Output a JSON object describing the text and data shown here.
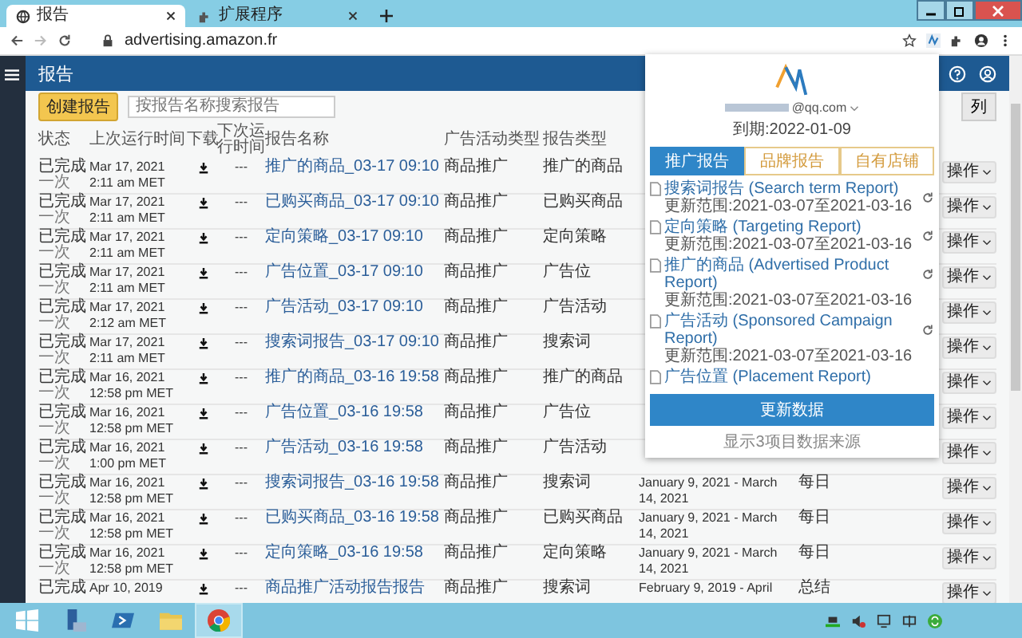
{
  "browser": {
    "tabs": [
      {
        "title": "报告",
        "selected": true
      },
      {
        "title": "扩展程序",
        "selected": false
      }
    ],
    "url": "advertising.amazon.fr"
  },
  "app": {
    "title": "报告",
    "create_button": "创建报告",
    "search": {
      "placeholder": "按报告名称搜索报告"
    },
    "columns_button": "列"
  },
  "table": {
    "columns": [
      "状态",
      "上次运行时间",
      "下载",
      "下次运行时间",
      "报告名称",
      "广告活动类型",
      "报告类型"
    ],
    "rows": [
      {
        "status": "已完成",
        "schedule": "一次",
        "last_run_date": "Mar 17, 2021",
        "last_run_time": "2:11 am MET",
        "next_run": "---",
        "name": "推广的商品_03-17 09:10",
        "campaign_type": "商品推广",
        "report_type": "推广的商品",
        "action": "操作"
      },
      {
        "status": "已完成",
        "schedule": "一次",
        "last_run_date": "Mar 17, 2021",
        "last_run_time": "2:11 am MET",
        "next_run": "---",
        "name": "已购买商品_03-17 09:10",
        "campaign_type": "商品推广",
        "report_type": "已购买商品",
        "action": "操作"
      },
      {
        "status": "已完成",
        "schedule": "一次",
        "last_run_date": "Mar 17, 2021",
        "last_run_time": "2:11 am MET",
        "next_run": "---",
        "name": "定向策略_03-17 09:10",
        "campaign_type": "商品推广",
        "report_type": "定向策略",
        "action": "操作"
      },
      {
        "status": "已完成",
        "schedule": "一次",
        "last_run_date": "Mar 17, 2021",
        "last_run_time": "2:11 am MET",
        "next_run": "---",
        "name": "广告位置_03-17 09:10",
        "campaign_type": "商品推广",
        "report_type": "广告位",
        "action": "操作"
      },
      {
        "status": "已完成",
        "schedule": "一次",
        "last_run_date": "Mar 17, 2021",
        "last_run_time": "2:12 am MET",
        "next_run": "---",
        "name": "广告活动_03-17 09:10",
        "campaign_type": "商品推广",
        "report_type": "广告活动",
        "action": "操作"
      },
      {
        "status": "已完成",
        "schedule": "一次",
        "last_run_date": "Mar 17, 2021",
        "last_run_time": "2:11 am MET",
        "next_run": "---",
        "name": "搜索词报告_03-17 09:10",
        "campaign_type": "商品推广",
        "report_type": "搜索词",
        "action": "操作"
      },
      {
        "status": "已完成",
        "schedule": "一次",
        "last_run_date": "Mar 16, 2021",
        "last_run_time": "12:58 pm MET",
        "next_run": "---",
        "name": "推广的商品_03-16 19:58",
        "campaign_type": "商品推广",
        "report_type": "推广的商品",
        "action": "操作"
      },
      {
        "status": "已完成",
        "schedule": "一次",
        "last_run_date": "Mar 16, 2021",
        "last_run_time": "12:58 pm MET",
        "next_run": "---",
        "name": "广告位置_03-16 19:58",
        "campaign_type": "商品推广",
        "report_type": "广告位",
        "action": "操作"
      },
      {
        "status": "已完成",
        "schedule": "一次",
        "last_run_date": "Mar 16, 2021",
        "last_run_time": "1:00 pm MET",
        "next_run": "---",
        "name": "广告活动_03-16 19:58",
        "campaign_type": "商品推广",
        "report_type": "广告活动",
        "action": "操作"
      },
      {
        "status": "已完成",
        "schedule": "一次",
        "last_run_date": "Mar 16, 2021",
        "last_run_time": "12:58 pm MET",
        "next_run": "---",
        "name": "搜索词报告_03-16 19:58",
        "campaign_type": "商品推广",
        "report_type": "搜索词",
        "date_range": "January 9, 2021 - March 14, 2021",
        "frequency": "每日",
        "action": "操作"
      },
      {
        "status": "已完成",
        "schedule": "一次",
        "last_run_date": "Mar 16, 2021",
        "last_run_time": "12:58 pm MET",
        "next_run": "---",
        "name": "已购买商品_03-16 19:58",
        "campaign_type": "商品推广",
        "report_type": "已购买商品",
        "date_range": "January 9, 2021 - March 14, 2021",
        "frequency": "每日",
        "action": "操作"
      },
      {
        "status": "已完成",
        "schedule": "一次",
        "last_run_date": "Mar 16, 2021",
        "last_run_time": "12:58 pm MET",
        "next_run": "---",
        "name": "定向策略_03-16 19:58",
        "campaign_type": "商品推广",
        "report_type": "定向策略",
        "date_range": "January 9, 2021 - March 14, 2021",
        "frequency": "每日",
        "action": "操作"
      },
      {
        "status": "已完成",
        "last_run_date": "Apr 10, 2019",
        "next_run": "---",
        "name": "商品推广活动报告报告",
        "campaign_type": "商品推广",
        "report_type": "搜索词",
        "date_range": "February 9, 2019 - April",
        "frequency": "总结",
        "action": "操作"
      }
    ]
  },
  "popup": {
    "email": "@qq.com",
    "expiry": "到期:2022-01-09",
    "tabs": [
      {
        "label": "推广报告",
        "selected": true
      },
      {
        "label": "品牌报告",
        "selected": false
      },
      {
        "label": "自有店铺",
        "selected": false
      }
    ],
    "reports": [
      {
        "title": "搜索词报告 (Search term Report)",
        "range": "更新范围:2021-03-07至2021-03-16"
      },
      {
        "title": "定向策略 (Targeting Report)",
        "range": "更新范围:2021-03-07至2021-03-16"
      },
      {
        "title": "推广的商品 (Advertised Product Report)",
        "range": "更新范围:2021-03-07至2021-03-16"
      },
      {
        "title": "广告活动 (Sponsored Campaign Report)",
        "range": "更新范围:2021-03-07至2021-03-16"
      },
      {
        "title": "广告位置 (Placement Report)"
      }
    ],
    "update_button": "更新数据",
    "footer": "显示3项目数据来源"
  },
  "taskbar": {
    "apps": [
      {
        "kind": "start",
        "selected": false
      },
      {
        "kind": "server",
        "selected": false
      },
      {
        "kind": "shell",
        "selected": false
      },
      {
        "kind": "folder",
        "selected": false
      },
      {
        "kind": "chrome",
        "selected": true
      }
    ],
    "tray": [
      {
        "kind": "network"
      },
      {
        "kind": "speaker"
      },
      {
        "kind": "monitor"
      },
      {
        "kind": "ime"
      },
      {
        "kind": "sync"
      }
    ]
  }
}
